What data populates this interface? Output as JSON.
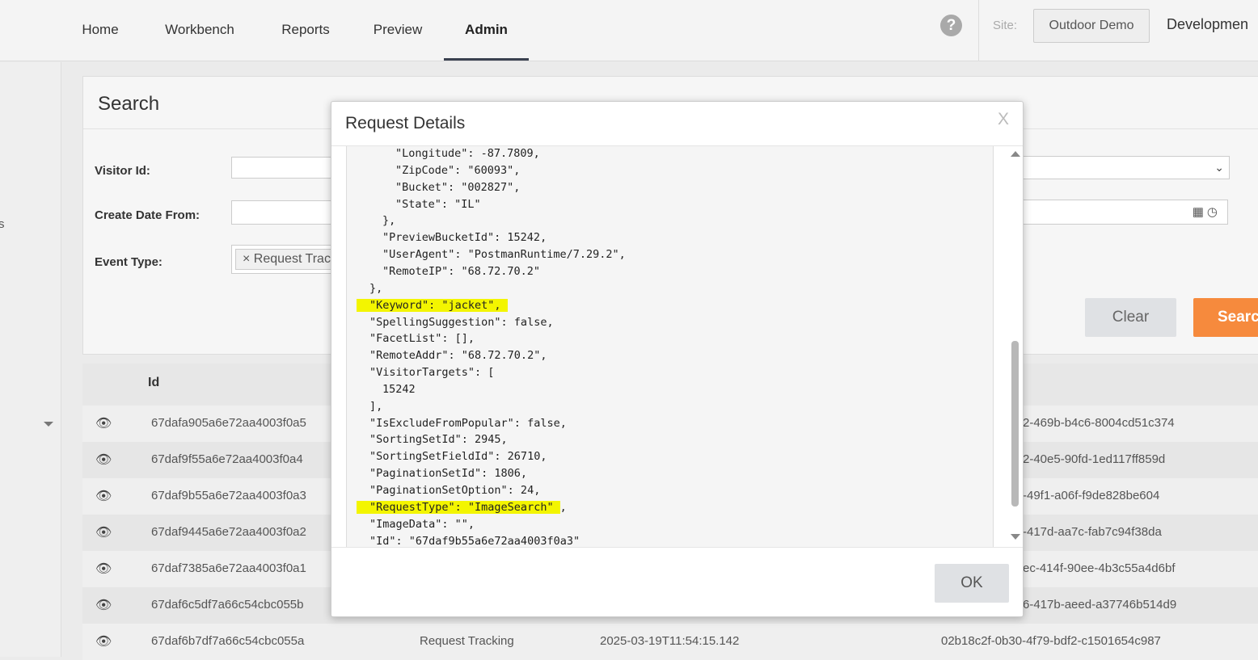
{
  "nav": {
    "items": [
      {
        "label": "Home",
        "active": false
      },
      {
        "label": "Workbench",
        "active": false
      },
      {
        "label": "Reports",
        "active": false
      },
      {
        "label": "Preview",
        "active": false
      },
      {
        "label": "Admin",
        "active": true
      }
    ],
    "help_icon": "?",
    "site_label": "Site:",
    "site_value": "Outdoor Demo",
    "environment": "Developmen"
  },
  "leftbar": {
    "partial_text": "s"
  },
  "search": {
    "title": "Search",
    "visitor_id_label": "Visitor Id:",
    "visitor_id_value": "",
    "create_date_from_label": "Create Date From:",
    "create_date_from_value": "",
    "event_type_label": "Event Type:",
    "event_type_tag": "× Request Trac",
    "clear_label": "Clear",
    "search_label": "Searc",
    "accent_color": "#f68a3d"
  },
  "table": {
    "id_header": "Id",
    "rows": [
      {
        "id": "67dafa905a6e72aa4003f0a5",
        "guid": "2-469b-b4c6-8004cd51c374"
      },
      {
        "id": "67daf9f55a6e72aa4003f0a4",
        "guid": "2-40e5-90fd-1ed117ff859d"
      },
      {
        "id": "67daf9b55a6e72aa4003f0a3",
        "guid": "-49f1-a06f-f9de828be604"
      },
      {
        "id": "67daf9445a6e72aa4003f0a2",
        "guid": "-417d-aa7c-fab7c94f38da"
      },
      {
        "id": "67daf7385a6e72aa4003f0a1",
        "guid": "ec-414f-90ee-4b3c55a4d6bf"
      },
      {
        "id": "67daf6c5df7a66c54cbc055b",
        "guid": "6-417b-aeed-a37746b514d9"
      },
      {
        "id": "67daf6b7df7a66c54cbc055a",
        "type": "Request Tracking",
        "date": "2025-03-19T11:54:15.142",
        "guid": "02b18c2f-0b30-4f79-bdf2-c1501654c987"
      }
    ]
  },
  "modal": {
    "title": "Request Details",
    "close": "X",
    "ok_label": "OK",
    "highlight_color": "#f3f500",
    "json_lines": [
      {
        "text": "\"Longitude\": -87.7809,",
        "indent": 3
      },
      {
        "text": "\"ZipCode\": \"60093\",",
        "indent": 3
      },
      {
        "text": "\"Bucket\": \"002827\",",
        "indent": 3
      },
      {
        "text": "\"State\": \"IL\"",
        "indent": 3
      },
      {
        "text": "},",
        "indent": 2
      },
      {
        "text": "\"PreviewBucketId\": 15242,",
        "indent": 2
      },
      {
        "text": "\"UserAgent\": \"PostmanRuntime/7.29.2\",",
        "indent": 2
      },
      {
        "text": "\"RemoteIP\": \"68.72.70.2\"",
        "indent": 2
      },
      {
        "text": "},",
        "indent": 1
      },
      {
        "text": "\"Keyword\": \"jacket\",",
        "indent": 1,
        "highlight": true
      },
      {
        "text": "\"SpellingSuggestion\": false,",
        "indent": 1
      },
      {
        "text": "\"FacetList\": [],",
        "indent": 1
      },
      {
        "text": "\"RemoteAddr\": \"68.72.70.2\",",
        "indent": 1
      },
      {
        "text": "\"VisitorTargets\": [",
        "indent": 1
      },
      {
        "text": "15242",
        "indent": 2
      },
      {
        "text": "],",
        "indent": 1
      },
      {
        "text": "\"IsExcludeFromPopular\": false,",
        "indent": 1
      },
      {
        "text": "\"SortingSetId\": 2945,",
        "indent": 1
      },
      {
        "text": "\"SortingSetFieldId\": 26710,",
        "indent": 1
      },
      {
        "text": "\"PaginationSetId\": 1806,",
        "indent": 1
      },
      {
        "text": "\"PaginationSetOption\": 24,",
        "indent": 1
      },
      {
        "text": "\"RequestType\": \"ImageSearch\"",
        "suffix": ",",
        "indent": 1,
        "highlight": true
      },
      {
        "text": "\"ImageData\": \"\",",
        "indent": 1
      },
      {
        "text": "\"Id\": \"67daf9b55a6e72aa4003f0a3\"",
        "indent": 1
      }
    ]
  }
}
